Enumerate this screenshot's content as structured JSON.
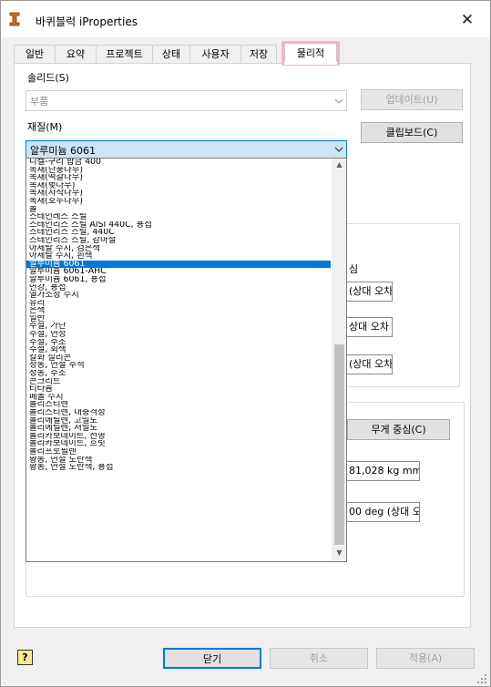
{
  "window": {
    "title": "바퀴블럭 iProperties",
    "close_glyph": "✕"
  },
  "tabs": [
    "일반",
    "요약",
    "프로젝트",
    "상태",
    "사용자",
    "저장",
    "물리적"
  ],
  "active_tab": "물리적",
  "solid": {
    "label": "솔리드(S)",
    "value": "부품"
  },
  "material": {
    "label": "재질(M)",
    "value": "알루미늄 6061"
  },
  "buttons": {
    "update": "업데이트(U)",
    "clipboard": "클립보드(C)",
    "center_of_gravity": "무게 중심(C)",
    "close": "닫기",
    "cancel": "취소",
    "apply": "적용(A)"
  },
  "partial_text": {
    "right_label": "심",
    "field1": "(상대 오차",
    "field2": "상대 오차",
    "field3": "(상대 오차",
    "moment": "81,028 kg mm^",
    "angle": "00 deg (상대 오"
  },
  "help_glyph": "?",
  "material_list": [
    "니켈-구리 합금 400",
    "목재(단풍나무)",
    "목재(떡갈나무)",
    "목재(벚나무)",
    "목재(자작나무)",
    "목재(호두나무)",
    "몰",
    "스테인레스 스틸",
    "스테인리스 스틸 AISI 440C, 용접",
    "스테인리스 스틸, 440C",
    "스테인리스 스틸, 감마철",
    "아세탈 수지, 검은색",
    "아세탈 수지, 흰색",
    "알루미늄 6061",
    "알루미늄 6061-AHC",
    "알루미늄 6061, 용접",
    "연강, 용접",
    "열가소성 수지",
    "유리",
    "은색",
    "일반",
    "주철, 가단",
    "주철, 연성",
    "주철, 주조",
    "주철, 회색",
    "칼화 실리콘",
    "청동, 연철 주석",
    "청동, 주조",
    "콘크리트",
    "티타늄",
    "페놀 수지",
    "폴리스티렌",
    "폴리스티렌, 내충격성",
    "폴리에틸렌, 고밀도",
    "폴리에틸렌, 저밀도",
    "폴리카보네이트, 선명",
    "폴리카보네이트, 흐릿",
    "폴리프로필렌",
    "황동, 연철 노란색",
    "황동, 연철 노란색, 용접"
  ],
  "selected_material": "알루미늄 6061",
  "colors": {
    "selection": "#0078d7",
    "tab_highlight": "#f6aab9",
    "app_icon": "#d2691e"
  }
}
